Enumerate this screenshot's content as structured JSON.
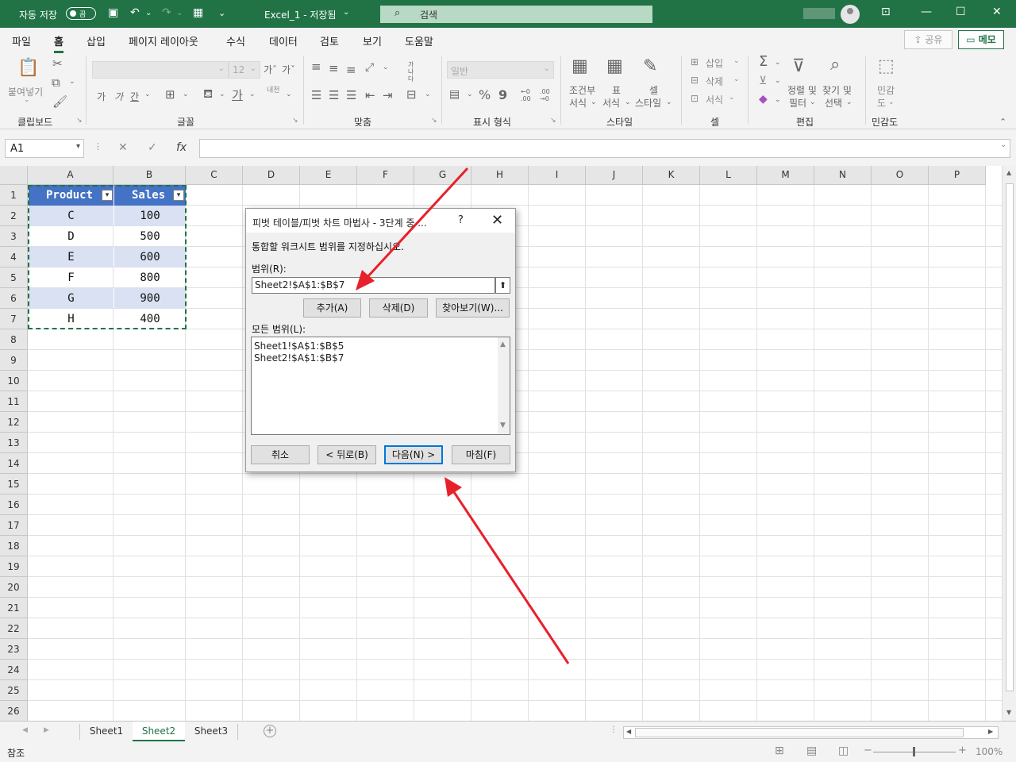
{
  "titlebar": {
    "autosave_label": "자동 저장",
    "autosave_state": "끔",
    "doc_title": "Excel_1 - 저장됨",
    "doc_title_caret": "⌄",
    "search_placeholder": "검색",
    "icons": [
      "save-icon",
      "undo-icon",
      "redo-icon",
      "form-icon",
      "customize-icon",
      "search-icon",
      "account-avatar",
      "ribbon-display-icon",
      "minimize-icon",
      "maximize-icon",
      "close-icon"
    ]
  },
  "ribbon": {
    "tabs": [
      "파일",
      "홈",
      "삽입",
      "페이지 레이아웃",
      "수식",
      "데이터",
      "검토",
      "보기",
      "도움말"
    ],
    "active_tab": "홈",
    "share_label": "공유",
    "memo_label": "메모",
    "groups": {
      "clipboard": {
        "label": "클립보드",
        "paste": "붙여넣기"
      },
      "font": {
        "label": "글꼴",
        "size": "12",
        "bold": "가",
        "italic": "가",
        "underline": "간",
        "grow": "가ˆ",
        "shrink": "가ˇ"
      },
      "alignment": {
        "label": "맞춤",
        "wrap": "가나다"
      },
      "number": {
        "label": "표시 형식",
        "format": "일반",
        "percent": "%",
        "comma": "9",
        "inc": "←0 .00",
        "dec": ".00 →0"
      },
      "styles": {
        "label": "스타일",
        "conditional": [
          "조건부",
          "서식"
        ],
        "table": [
          "표",
          "서식"
        ],
        "cell_styles": [
          "셀",
          "스타일"
        ]
      },
      "cells": {
        "label": "셀",
        "insert": "삽입",
        "delete": "삭제",
        "format": "서식"
      },
      "editing": {
        "label": "편집",
        "sort": [
          "정렬 및",
          "필터"
        ],
        "find": [
          "찾기 및",
          "선택"
        ]
      },
      "sensitivity": {
        "label": "민감도",
        "button": [
          "민감",
          "도"
        ]
      }
    }
  },
  "formula_bar": {
    "name_box": "A1",
    "cancel": "✕",
    "enter": "✓",
    "fx": "fx",
    "value": ""
  },
  "grid": {
    "columns": [
      "A",
      "B",
      "C",
      "D",
      "E",
      "F",
      "G",
      "H",
      "I",
      "J",
      "K",
      "L",
      "M",
      "N",
      "O",
      "P"
    ],
    "rows": [
      "1",
      "2",
      "3",
      "4",
      "5",
      "6",
      "7",
      "8",
      "9",
      "10",
      "11",
      "12",
      "13",
      "14",
      "15",
      "16",
      "17",
      "18",
      "19",
      "20",
      "21",
      "22",
      "23",
      "24",
      "25",
      "26"
    ],
    "table": {
      "headers": [
        "Product",
        "Sales"
      ],
      "rows": [
        [
          "C",
          "100"
        ],
        [
          "D",
          "500"
        ],
        [
          "E",
          "600"
        ],
        [
          "F",
          "800"
        ],
        [
          "G",
          "900"
        ],
        [
          "H",
          "400"
        ]
      ]
    }
  },
  "sheets": {
    "tabs": [
      "Sheet1",
      "Sheet2",
      "Sheet3"
    ],
    "active": "Sheet2",
    "add": "+"
  },
  "status": {
    "mode": "참조",
    "zoom": "100%",
    "zoom_minus": "−",
    "zoom_plus": "+"
  },
  "dialog": {
    "title": "피벗 테이블/피벗 차트 마법사 - 3단계 중 ...",
    "help": "?",
    "close": "✕",
    "instruction": "통합할 워크시트 범위를 지정하십시오.",
    "range_label": "범위(R):",
    "range_value": "Sheet2!$A$1:$B$7",
    "add_btn": "추가(A)",
    "delete_btn": "삭제(D)",
    "browse_btn": "찾아보기(W)...",
    "all_ranges_label": "모든 범위(L):",
    "all_ranges": [
      "Sheet1!$A$1:$B$5",
      "Sheet2!$A$1:$B$7"
    ],
    "cancel_btn": "취소",
    "back_btn": "< 뒤로(B)",
    "next_btn": "다음(N) >",
    "finish_btn": "마침(F)"
  },
  "colors": {
    "excel_green": "#217346",
    "table_header": "#4472c4",
    "table_band": "#d9e1f2",
    "annotation_arrow": "#e8202a"
  }
}
